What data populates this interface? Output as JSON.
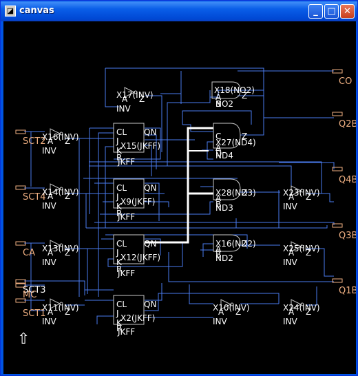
{
  "window": {
    "title": "canvas",
    "icon": "app-window-icon",
    "min_glyph": "_",
    "max_glyph": "□",
    "close_glyph": "✕"
  },
  "colors": {
    "wire": "#4a7cf0",
    "selected_wire": "#ffffff",
    "instance_text": "#ffffff",
    "pin_text": "#f0b082",
    "gate": "#c8c8c8"
  },
  "ports": {
    "left": [
      "SCT2",
      "SCT4",
      "CA",
      "SCT3",
      "MC",
      "SCT1"
    ],
    "right": [
      "CO",
      "Q2B",
      "Q4B",
      "Q3B",
      "Q1B"
    ]
  },
  "instances": {
    "x17": {
      "name": "X17(INV)",
      "cell": "INV",
      "a": "A",
      "z": "Z"
    },
    "x16": {
      "name": "X16(INV)",
      "cell": "INV",
      "a": "A",
      "z": "Z"
    },
    "x14": {
      "name": "X14(INV)",
      "cell": "INV",
      "a": "A",
      "z": "Z"
    },
    "x13": {
      "name": "X13(INV)",
      "cell": "INV",
      "a": "A",
      "z": "Z"
    },
    "x11": {
      "name": "X11(INV)",
      "cell": "INV",
      "a": "A",
      "z": "Z"
    },
    "x23": {
      "name": "X23(INV)",
      "cell": "INV",
      "a": "A",
      "z": "Z"
    },
    "x25": {
      "name": "X25(INV)",
      "cell": "INV",
      "a": "A",
      "z": "Z"
    },
    "x10": {
      "name": "X10(INV)",
      "cell": "INV",
      "a": "A",
      "z": "Z"
    },
    "x24": {
      "name": "X24(INV)",
      "cell": "INV",
      "a": "A",
      "z": "Z"
    },
    "x15": {
      "name": "X15(JKFF)",
      "cell": "JKFF",
      "cl": "CL",
      "qn": "QN",
      "j": "J",
      "k": "K",
      "r": "R"
    },
    "x9": {
      "name": "X9(JKFF)",
      "cell": "JKFF",
      "cl": "CL",
      "qn": "QN",
      "j": "J",
      "k": "K",
      "r": "R"
    },
    "x12": {
      "name": "X12(JKFF)",
      "cell": "JKFF",
      "cl": "CL",
      "qn": "QN",
      "j": "J",
      "k": "K",
      "r": "R"
    },
    "x2": {
      "name": "X2(JKFF)",
      "cell": "JKFF",
      "cl": "CL",
      "qn": "QN",
      "j": "J",
      "k": "K",
      "r": "R"
    },
    "x18": {
      "name": "X18(NO2)",
      "cell": "NO2",
      "a": "A",
      "b": "B",
      "z": "Z"
    },
    "x27": {
      "name": "X27(ND4)",
      "cell": "ND4",
      "a": "A",
      "b": "B",
      "c": "C",
      "d": "D",
      "z": "Z"
    },
    "x28": {
      "name": "X28(ND3)",
      "cell": "ND3",
      "a": "A",
      "b": "B",
      "z": "Z"
    },
    "x26": {
      "name": "X16(ND2)",
      "cell": "ND2",
      "a": "A",
      "b": "B",
      "z": "Z"
    }
  },
  "cursor": {
    "icon": "up-arrow-icon",
    "glyph": "⇧"
  }
}
